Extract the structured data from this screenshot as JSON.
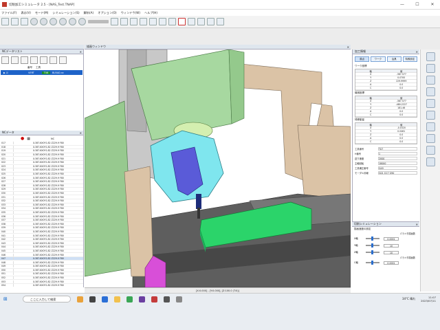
{
  "window": {
    "title": "切削加工シミュレータ 2.5 - [NAS_Test.TNAP]",
    "min": "—",
    "max": "☐",
    "close": "✕"
  },
  "menu": [
    "ファイル(F)",
    "表示(V)",
    "モード(M)",
    "シミュレーション(S)",
    "解析(A)",
    "オプション(O)",
    "ウィンドウ(W)",
    "ヘルプ(H)"
  ],
  "left_top": {
    "header": "NCデータリスト",
    "cols": [
      "番号",
      "工具"
    ],
    "selected_row": {
      "id": "VERT",
      "tool": "T06",
      "file": "BLRAD.nc"
    }
  },
  "left_bottom": {
    "header": "NCデータ",
    "col_header": "NC",
    "rows": [
      {
        "n": "017",
        "c": "X-387.6X0Y1.82 Z229.9 F80"
      },
      {
        "n": "018",
        "c": "X-387.6X0Y1.82 Z229.9 F80"
      },
      {
        "n": "019",
        "c": "X-387.6X0Y1.82 Z229.9 F80"
      },
      {
        "n": "020",
        "c": "X-387.6X0Y1.82 Z229.9 F80"
      },
      {
        "n": "021",
        "c": "X-387.6X0Y1.82 Z229.9 F80"
      },
      {
        "n": "022",
        "c": "X-387.6X0Y1.82 Z229.9 F80"
      },
      {
        "n": "023",
        "c": "X-387.6X0Y1.82 Z229.9 F80"
      },
      {
        "n": "024",
        "c": "X-387.6X0Y1.82 Z229.9 F80"
      },
      {
        "n": "025",
        "c": "X-387.6X0Y1.82 Z229.9 F80"
      },
      {
        "n": "026",
        "c": "X-387.6X0Y1.82 Z229.9 F80"
      },
      {
        "n": "027",
        "c": "X-387.6X0Y1.82 Z229.9 F80"
      },
      {
        "n": "028",
        "c": "X-387.6X0Y1.82 Z229.9 F80"
      },
      {
        "n": "029",
        "c": "X-387.6X0Y1.82 Z229.9 F80"
      },
      {
        "n": "030",
        "c": "X-387.6X0Y1.82 Z229.9 F80"
      },
      {
        "n": "031",
        "c": "X-387.6X0Y1.82 Z229.9 F80"
      },
      {
        "n": "032",
        "c": "X-387.6X0Y1.82 Z229.9 F80"
      },
      {
        "n": "033",
        "c": "X-387.6X0Y1.82 Z229.9 F80"
      },
      {
        "n": "034",
        "c": "X-387.6X0Y1.82 Z229.9 F80"
      },
      {
        "n": "035",
        "c": "X-387.6X0Y1.82 Z229.9 F80"
      },
      {
        "n": "036",
        "c": "X-387.6X0Y1.82 Z229.9 F80"
      },
      {
        "n": "037",
        "c": "X-387.6X0Y1.82 Z229.9 F80"
      },
      {
        "n": "038",
        "c": "X-387.6X0Y1.82 Z229.9 F80"
      },
      {
        "n": "039",
        "c": "X-387.6X0Y1.82 Z229.9 F80"
      },
      {
        "n": "040",
        "c": "X-387.6X0Y1.82 Z229.9 F80"
      },
      {
        "n": "041",
        "c": "X-387.6X0Y1.82 Z229.9 F80"
      },
      {
        "n": "042",
        "c": "X-387.6X0Y1.82 Z229.9 F80"
      },
      {
        "n": "043",
        "c": "X-387.6X0Y1.82 Z229.9 F80"
      },
      {
        "n": "044",
        "c": "X-387.6X0Y1.82 Z229.9 F80"
      },
      {
        "n": "045",
        "c": "X-387.6X0Y1.82 Z229.9 F80"
      },
      {
        "n": "046",
        "c": "X-387.6X0Y1.82 Z229.9 F80"
      },
      {
        "n": "047",
        "c": "X-387.6X0Y1.82 Z229.9 F80"
      },
      {
        "n": "048",
        "c": "X-387.6X0Y1.82 Z229.9 F80"
      },
      {
        "n": "049",
        "c": "X-387.6X0Y1.82 Z229.9 F80"
      },
      {
        "n": "050",
        "c": "X-387.6X0Y1.82 Z229.9 F80"
      },
      {
        "n": "051",
        "c": "X-387.6X0Y1.82 Z229.9 F80"
      },
      {
        "n": "052",
        "c": "X-387.6X0Y1.82 Z229.9 F80"
      },
      {
        "n": "053",
        "c": "X-387.6X0Y1.82 Z229.9 F80"
      },
      {
        "n": "054",
        "c": "X-387.6X0Y1.82 Z229.9 F80"
      },
      {
        "n": "055",
        "c": "X-387.6X0Y1.82 Z229.9 F80"
      }
    ]
  },
  "viewport": {
    "header": "描画ウィンドウ",
    "status": "[X:0.000] - [Y:0.000], [Z:100.0 (T:0)]"
  },
  "right_panel": {
    "header": "加工情報",
    "tabs": [
      "原点",
      "ワーク",
      "治具",
      "特殊設定"
    ],
    "section1": "ワーク座標",
    "grid_header": [
      "軸",
      "値"
    ],
    "grid1": [
      [
        "X",
        "-387.577"
      ],
      [
        "Y",
        "0.0700"
      ],
      [
        "Z",
        "229.9999"
      ],
      [
        "A",
        "0.0"
      ],
      [
        "C",
        "0.0"
      ]
    ],
    "section2": "機械座標",
    "grid2": [
      [
        "X",
        "-387.577"
      ],
      [
        "Y",
        "-480.2227"
      ],
      [
        "Z",
        "181.46"
      ],
      [
        "A",
        "0.0"
      ],
      [
        "C",
        "0.0"
      ]
    ],
    "section3": "残移動量",
    "grid3": [
      [
        "X",
        "-0.0320"
      ],
      [
        "Y",
        "0.0461"
      ],
      [
        "Z",
        "0.0"
      ],
      [
        "A",
        "0.0"
      ],
      [
        "C",
        "0.0"
      ]
    ],
    "kv": [
      {
        "k": "工具番号",
        "v": "T07"
      },
      {
        "k": "H番号",
        "v": "1"
      },
      {
        "k": "送り速度",
        "v": "2000"
      },
      {
        "k": "主軸回転",
        "v": "18000"
      },
      {
        "k": "工具補正番号",
        "v": "G49"
      },
      {
        "k": "モーダル情報",
        "v": "G01 G17 G90"
      }
    ]
  },
  "right_bottom": {
    "header": "切削シミュレーション",
    "sub": "描画速度の設定",
    "rows": [
      {
        "label": "X軸",
        "caption": "パラメタ描画数",
        "value": "0.0001"
      },
      {
        "label": "Y軸",
        "caption": "",
        "value": "10"
      },
      {
        "label": "Z軸",
        "caption": "",
        "value": "10"
      },
      {
        "label": "C軸",
        "caption": "パラメタ描画数",
        "value": "0.0001"
      }
    ]
  },
  "taskbar": {
    "search_placeholder": "ここに入力して検索",
    "weather": "34°C 晴れ",
    "time": "11:07",
    "date": "2023/07/11"
  },
  "colors": {
    "guard_green": "#a7d8a0",
    "spindle_cyan": "#7fe6ee",
    "tool_blue": "#5a5bd8",
    "part_green": "#2bd46a",
    "wall_tan": "#dbc3a6",
    "fixture_magenta": "#d84fd8"
  }
}
